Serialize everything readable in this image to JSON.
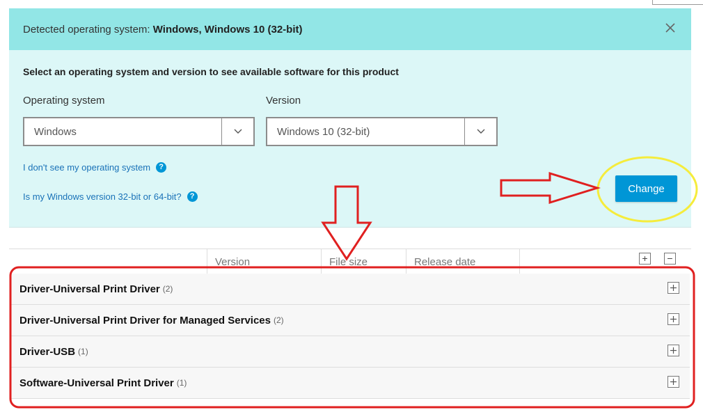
{
  "detected": {
    "label": "Detected operating system:",
    "value": "Windows, Windows 10 (32-bit)"
  },
  "selector": {
    "heading": "Select an operating system and version to see available software for this product",
    "os_label": "Operating system",
    "os_value": "Windows",
    "version_label": "Version",
    "version_value": "Windows 10 (32-bit)",
    "help_os": "I don't see my operating system",
    "help_bits": "Is my Windows version 32-bit or 64-bit?",
    "help_glyph": "?",
    "change_button": "Change"
  },
  "table": {
    "columns": [
      "Version",
      "File size",
      "Release date"
    ],
    "expand_all": "+",
    "collapse_all": "−",
    "rows": [
      {
        "title": "Driver-Universal Print Driver",
        "count": "(2)"
      },
      {
        "title": "Driver-Universal Print Driver for Managed Services",
        "count": "(2)"
      },
      {
        "title": "Driver-USB",
        "count": "(1)"
      },
      {
        "title": "Software-Universal Print Driver",
        "count": "(1)"
      }
    ]
  },
  "annotations": {
    "arrow_color": "#e02020",
    "highlight_color": "#f5ec3c",
    "box_color": "#e02020"
  },
  "colors": {
    "detected_bg": "#92e6e6",
    "panel_bg": "#dcf7f7",
    "accent": "#0096d6",
    "link": "#1a72b8"
  }
}
